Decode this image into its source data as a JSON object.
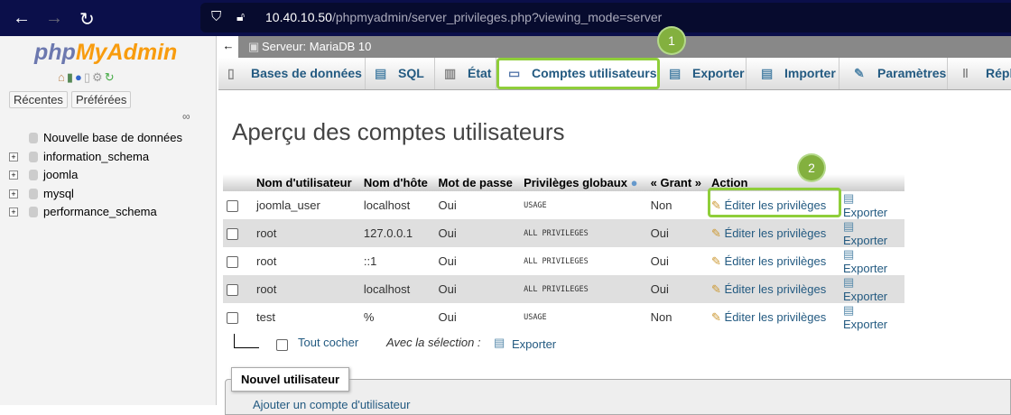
{
  "browser": {
    "url_host": "10.40.10.50",
    "url_path": "/phpmyadmin/server_privileges.php?viewing_mode=server"
  },
  "sidebar": {
    "logo_php": "php",
    "logo_myadmin": "MyAdmin",
    "recent": "Récentes",
    "favorites": "Préférées",
    "tree": [
      "Nouvelle base de données",
      "information_schema",
      "joomla",
      "mysql",
      "performance_schema"
    ]
  },
  "server": {
    "title": "Serveur: MariaDB 10"
  },
  "tabs": [
    "Bases de données",
    "SQL",
    "État",
    "Comptes utilisateurs",
    "Exporter",
    "Importer",
    "Paramètres",
    "Répl"
  ],
  "badges": [
    "1",
    "2"
  ],
  "page": {
    "title": "Aperçu des comptes utilisateurs"
  },
  "table": {
    "headers": [
      "Nom d'utilisateur",
      "Nom d'hôte",
      "Mot de passe",
      "Privilèges globaux",
      "« Grant »",
      "Action"
    ],
    "rows": [
      {
        "user": "joomla_user",
        "host": "localhost",
        "pass": "Oui",
        "priv": "USAGE",
        "grant": "Non"
      },
      {
        "user": "root",
        "host": "127.0.0.1",
        "pass": "Oui",
        "priv": "ALL PRIVILEGES",
        "grant": "Oui"
      },
      {
        "user": "root",
        "host": "::1",
        "pass": "Oui",
        "priv": "ALL PRIVILEGES",
        "grant": "Oui"
      },
      {
        "user": "root",
        "host": "localhost",
        "pass": "Oui",
        "priv": "ALL PRIVILEGES",
        "grant": "Oui"
      },
      {
        "user": "test",
        "host": "%",
        "pass": "Oui",
        "priv": "USAGE",
        "grant": "Non"
      }
    ],
    "edit_label": "Éditer les privilèges",
    "export_label": "Exporter"
  },
  "footer": {
    "check_all": "Tout cocher",
    "with_selection": "Avec la sélection :",
    "export": "Exporter"
  },
  "new_user": {
    "legend": "Nouvel utilisateur",
    "add": "Ajouter un compte d'utilisateur"
  }
}
